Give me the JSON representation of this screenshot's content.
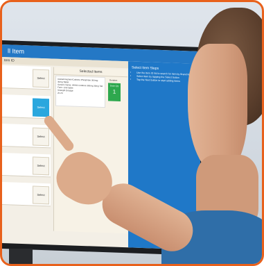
{
  "window": {
    "title": "ll Item",
    "subtitle": "tem ID"
  },
  "selected_panel": {
    "header": "Selected Items",
    "card_lines": [
      "Acetaminophen/Codeine Phosphate 300mg-30mg Tablet",
      "Generic Name: ##### Codeine 300mg 30mg Tab",
      "Form: Oral tablet",
      "Strength  Dosage",
      "20        20"
    ],
    "duration_label": "Duration",
    "duration_box_top": "Dose Qty",
    "duration_value": "1"
  },
  "list_rows": [
    {
      "button": "Select",
      "active": false
    },
    {
      "button": "Select",
      "active": true
    },
    {
      "button": "Select",
      "active": false
    },
    {
      "button": "Select",
      "active": false
    },
    {
      "button": "Select",
      "active": false
    }
  ],
  "help_panel": {
    "heading": "Select Item Steps",
    "steps": [
      "Use the Item ID list to search for item by Brand Name",
      "Select item by tapping the Select button",
      "Tap the Next button to start adding items"
    ]
  },
  "colors": {
    "frame_border": "#e8611c",
    "titlebar": "#2478c5",
    "active_select": "#2aa7de",
    "duration_green": "#2ea84e",
    "shirt": "#2f6ea8"
  }
}
